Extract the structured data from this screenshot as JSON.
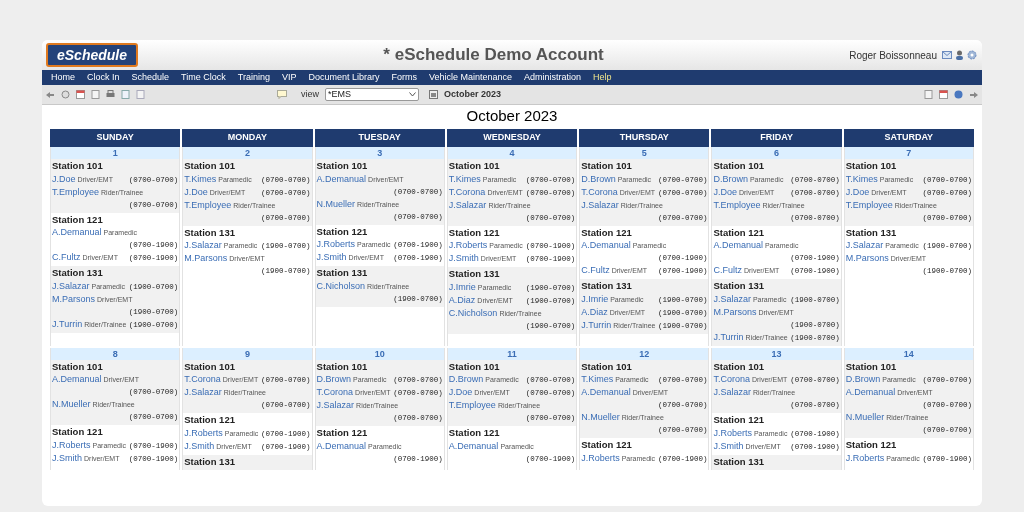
{
  "logo": "eSchedule",
  "title": "* eSchedule Demo Account",
  "user": "Roger Boissonneau",
  "nav": [
    {
      "label": "Home",
      "highlighted": false
    },
    {
      "label": "Clock In",
      "highlighted": false
    },
    {
      "label": "Schedule",
      "highlighted": false
    },
    {
      "label": "Time Clock",
      "highlighted": false
    },
    {
      "label": "Training",
      "highlighted": false
    },
    {
      "label": "VIP",
      "highlighted": false
    },
    {
      "label": "Document Library",
      "highlighted": false
    },
    {
      "label": "Forms",
      "highlighted": false
    },
    {
      "label": "Vehicle Maintenance",
      "highlighted": false
    },
    {
      "label": "Administration",
      "highlighted": false
    },
    {
      "label": "Help",
      "highlighted": true
    }
  ],
  "toolbar": {
    "view_label": "view",
    "view_value": "*EMS",
    "period": "October 2023"
  },
  "calendar_title": "October 2023",
  "weekdays": [
    "SUNDAY",
    "MONDAY",
    "TUESDAY",
    "WEDNESDAY",
    "THURSDAY",
    "FRIDAY",
    "SATURDAY"
  ],
  "weeks": [
    {
      "days": [
        {
          "date": "1",
          "stations": [
            {
              "name": "Station 101",
              "shifts": [
                {
                  "name": "J.Doe",
                  "role": "Driver/EMT",
                  "time": "(0700-0700)"
                },
                {
                  "name": "T.Employee",
                  "role": "Rider/Trainee",
                  "time": "(0700-0700)"
                }
              ]
            },
            {
              "name": "Station 121",
              "shifts": [
                {
                  "name": "A.Demanual",
                  "role": "Paramedic",
                  "time": "(0700-1900)"
                },
                {
                  "name": "C.Fultz",
                  "role": "Driver/EMT",
                  "time": "(0700-1900)"
                }
              ]
            },
            {
              "name": "Station 131",
              "shifts": [
                {
                  "name": "J.Salazar",
                  "role": "Paramedic",
                  "time": "(1900-0700)"
                },
                {
                  "name": "M.Parsons",
                  "role": "Driver/EMT",
                  "time": "(1900-0700)"
                },
                {
                  "name": "J.Turrin",
                  "role": "Rider/Trainee",
                  "time": "(1900-0700)"
                }
              ]
            }
          ]
        },
        {
          "date": "2",
          "stations": [
            {
              "name": "Station 101",
              "shifts": [
                {
                  "name": "T.Kimes",
                  "role": "Paramedic",
                  "time": "(0700-0700)"
                },
                {
                  "name": "J.Doe",
                  "role": "Driver/EMT",
                  "time": "(0700-0700)"
                },
                {
                  "name": "T.Employee",
                  "role": "Rider/Trainee",
                  "time": "(0700-0700)"
                }
              ]
            },
            {
              "name": "Station 131",
              "shifts": [
                {
                  "name": "J.Salazar",
                  "role": "Paramedic",
                  "time": "(1900-0700)"
                },
                {
                  "name": "M.Parsons",
                  "role": "Driver/EMT",
                  "time": "(1900-0700)"
                }
              ]
            }
          ]
        },
        {
          "date": "3",
          "stations": [
            {
              "name": "Station 101",
              "shifts": [
                {
                  "name": "A.Demanual",
                  "role": "Driver/EMT",
                  "time": "(0700-0700)"
                },
                {
                  "name": "N.Mueller",
                  "role": "Rider/Trainee",
                  "time": "(0700-0700)"
                }
              ]
            },
            {
              "name": "Station 121",
              "shifts": [
                {
                  "name": "J.Roberts",
                  "role": "Paramedic",
                  "time": "(0700-1900)"
                },
                {
                  "name": "J.Smith",
                  "role": "Driver/EMT",
                  "time": "(0700-1900)"
                }
              ]
            },
            {
              "name": "Station 131",
              "shifts": [
                {
                  "name": "C.Nicholson",
                  "role": "Rider/Trainee",
                  "time": "(1900-0700)"
                }
              ]
            }
          ]
        },
        {
          "date": "4",
          "stations": [
            {
              "name": "Station 101",
              "shifts": [
                {
                  "name": "T.Kimes",
                  "role": "Paramedic",
                  "time": "(0700-0700)"
                },
                {
                  "name": "T.Corona",
                  "role": "Driver/EMT",
                  "time": "(0700-0700)"
                },
                {
                  "name": "J.Salazar",
                  "role": "Rider/Trainee",
                  "time": "(0700-0700)"
                }
              ]
            },
            {
              "name": "Station 121",
              "shifts": [
                {
                  "name": "J.Roberts",
                  "role": "Paramedic",
                  "time": "(0700-1900)"
                },
                {
                  "name": "J.Smith",
                  "role": "Driver/EMT",
                  "time": "(0700-1900)"
                }
              ]
            },
            {
              "name": "Station 131",
              "shifts": [
                {
                  "name": "J.Imrie",
                  "role": "Paramedic",
                  "time": "(1900-0700)"
                },
                {
                  "name": "A.Diaz",
                  "role": "Driver/EMT",
                  "time": "(1900-0700)"
                },
                {
                  "name": "C.Nicholson",
                  "role": "Rider/Trainee",
                  "time": "(1900-0700)"
                }
              ]
            }
          ]
        },
        {
          "date": "5",
          "stations": [
            {
              "name": "Station 101",
              "shifts": [
                {
                  "name": "D.Brown",
                  "role": "Paramedic",
                  "time": "(0700-0700)"
                },
                {
                  "name": "T.Corona",
                  "role": "Driver/EMT",
                  "time": "(0700-0700)"
                },
                {
                  "name": "J.Salazar",
                  "role": "Rider/Trainee",
                  "time": "(0700-0700)"
                }
              ]
            },
            {
              "name": "Station 121",
              "shifts": [
                {
                  "name": "A.Demanual",
                  "role": "Paramedic",
                  "time": "(0700-1900)"
                },
                {
                  "name": "C.Fultz",
                  "role": "Driver/EMT",
                  "time": "(0700-1900)"
                }
              ]
            },
            {
              "name": "Station 131",
              "shifts": [
                {
                  "name": "J.Imrie",
                  "role": "Paramedic",
                  "time": "(1900-0700)"
                },
                {
                  "name": "A.Diaz",
                  "role": "Driver/EMT",
                  "time": "(1900-0700)"
                },
                {
                  "name": "J.Turrin",
                  "role": "Rider/Trainee",
                  "time": "(1900-0700)"
                }
              ]
            }
          ]
        },
        {
          "date": "6",
          "stations": [
            {
              "name": "Station 101",
              "shifts": [
                {
                  "name": "D.Brown",
                  "role": "Paramedic",
                  "time": "(0700-0700)"
                },
                {
                  "name": "J.Doe",
                  "role": "Driver/EMT",
                  "time": "(0700-0700)"
                },
                {
                  "name": "T.Employee",
                  "role": "Rider/Trainee",
                  "time": "(0700-0700)"
                }
              ]
            },
            {
              "name": "Station 121",
              "shifts": [
                {
                  "name": "A.Demanual",
                  "role": "Paramedic",
                  "time": "(0700-1900)"
                },
                {
                  "name": "C.Fultz",
                  "role": "Driver/EMT",
                  "time": "(0700-1900)"
                }
              ]
            },
            {
              "name": "Station 131",
              "shifts": [
                {
                  "name": "J.Salazar",
                  "role": "Paramedic",
                  "time": "(1900-0700)"
                },
                {
                  "name": "M.Parsons",
                  "role": "Driver/EMT",
                  "time": "(1900-0700)"
                },
                {
                  "name": "J.Turrin",
                  "role": "Rider/Trainee",
                  "time": "(1900-0700)"
                }
              ]
            }
          ]
        },
        {
          "date": "7",
          "stations": [
            {
              "name": "Station 101",
              "shifts": [
                {
                  "name": "T.Kimes",
                  "role": "Paramedic",
                  "time": "(0700-0700)"
                },
                {
                  "name": "J.Doe",
                  "role": "Driver/EMT",
                  "time": "(0700-0700)"
                },
                {
                  "name": "T.Employee",
                  "role": "Rider/Trainee",
                  "time": "(0700-0700)"
                }
              ]
            },
            {
              "name": "Station 131",
              "shifts": [
                {
                  "name": "J.Salazar",
                  "role": "Paramedic",
                  "time": "(1900-0700)"
                },
                {
                  "name": "M.Parsons",
                  "role": "Driver/EMT",
                  "time": "(1900-0700)"
                }
              ]
            }
          ]
        }
      ]
    },
    {
      "days": [
        {
          "date": "8",
          "stations": [
            {
              "name": "Station 101",
              "shifts": [
                {
                  "name": "A.Demanual",
                  "role": "Driver/EMT",
                  "time": "(0700-0700)"
                },
                {
                  "name": "N.Mueller",
                  "role": "Rider/Trainee",
                  "time": "(0700-0700)"
                }
              ]
            },
            {
              "name": "Station 121",
              "shifts": [
                {
                  "name": "J.Roberts",
                  "role": "Paramedic",
                  "time": "(0700-1900)"
                },
                {
                  "name": "J.Smith",
                  "role": "Driver/EMT",
                  "time": "(0700-1900)"
                }
              ]
            }
          ]
        },
        {
          "date": "9",
          "stations": [
            {
              "name": "Station 101",
              "shifts": [
                {
                  "name": "T.Corona",
                  "role": "Driver/EMT",
                  "time": "(0700-0700)"
                },
                {
                  "name": "J.Salazar",
                  "role": "Rider/Trainee",
                  "time": "(0700-0700)"
                }
              ]
            },
            {
              "name": "Station 121",
              "shifts": [
                {
                  "name": "J.Roberts",
                  "role": "Paramedic",
                  "time": "(0700-1900)"
                },
                {
                  "name": "J.Smith",
                  "role": "Driver/EMT",
                  "time": "(0700-1900)"
                }
              ]
            },
            {
              "name": "Station 131"
            }
          ]
        },
        {
          "date": "10",
          "stations": [
            {
              "name": "Station 101",
              "shifts": [
                {
                  "name": "D.Brown",
                  "role": "Paramedic",
                  "time": "(0700-0700)"
                },
                {
                  "name": "T.Corona",
                  "role": "Driver/EMT",
                  "time": "(0700-0700)"
                },
                {
                  "name": "J.Salazar",
                  "role": "Rider/Trainee",
                  "time": "(0700-0700)"
                }
              ]
            },
            {
              "name": "Station 121",
              "shifts": [
                {
                  "name": "A.Demanual",
                  "role": "Paramedic",
                  "time": "(0700-1900)"
                }
              ]
            }
          ]
        },
        {
          "date": "11",
          "stations": [
            {
              "name": "Station 101",
              "shifts": [
                {
                  "name": "D.Brown",
                  "role": "Paramedic",
                  "time": "(0700-0700)"
                },
                {
                  "name": "J.Doe",
                  "role": "Driver/EMT",
                  "time": "(0700-0700)"
                },
                {
                  "name": "T.Employee",
                  "role": "Rider/Trainee",
                  "time": "(0700-0700)"
                }
              ]
            },
            {
              "name": "Station 121",
              "shifts": [
                {
                  "name": "A.Demanual",
                  "role": "Paramedic",
                  "time": "(0700-1900)"
                }
              ]
            }
          ]
        },
        {
          "date": "12",
          "stations": [
            {
              "name": "Station 101",
              "shifts": [
                {
                  "name": "T.Kimes",
                  "role": "Paramedic",
                  "time": "(0700-0700)"
                },
                {
                  "name": "A.Demanual",
                  "role": "Driver/EMT",
                  "time": "(0700-0700)"
                },
                {
                  "name": "N.Mueller",
                  "role": "Rider/Trainee",
                  "time": "(0700-0700)"
                }
              ]
            },
            {
              "name": "Station 121",
              "shifts": [
                {
                  "name": "J.Roberts",
                  "role": "Paramedic",
                  "time": "(0700-1900)"
                }
              ]
            }
          ]
        },
        {
          "date": "13",
          "stations": [
            {
              "name": "Station 101",
              "shifts": [
                {
                  "name": "T.Corona",
                  "role": "Driver/EMT",
                  "time": "(0700-0700)"
                },
                {
                  "name": "J.Salazar",
                  "role": "Rider/Trainee",
                  "time": "(0700-0700)"
                }
              ]
            },
            {
              "name": "Station 121",
              "shifts": [
                {
                  "name": "J.Roberts",
                  "role": "Paramedic",
                  "time": "(0700-1900)"
                },
                {
                  "name": "J.Smith",
                  "role": "Driver/EMT",
                  "time": "(0700-1900)"
                }
              ]
            },
            {
              "name": "Station 131"
            }
          ]
        },
        {
          "date": "14",
          "stations": [
            {
              "name": "Station 101",
              "shifts": [
                {
                  "name": "D.Brown",
                  "role": "Paramedic",
                  "time": "(0700-0700)"
                },
                {
                  "name": "A.Demanual",
                  "role": "Driver/EMT",
                  "time": "(0700-0700)"
                },
                {
                  "name": "N.Mueller",
                  "role": "Rider/Trainee",
                  "time": "(0700-0700)"
                }
              ]
            },
            {
              "name": "Station 121",
              "shifts": [
                {
                  "name": "J.Roberts",
                  "role": "Paramedic",
                  "time": "(0700-1900)"
                }
              ]
            }
          ]
        }
      ]
    }
  ]
}
